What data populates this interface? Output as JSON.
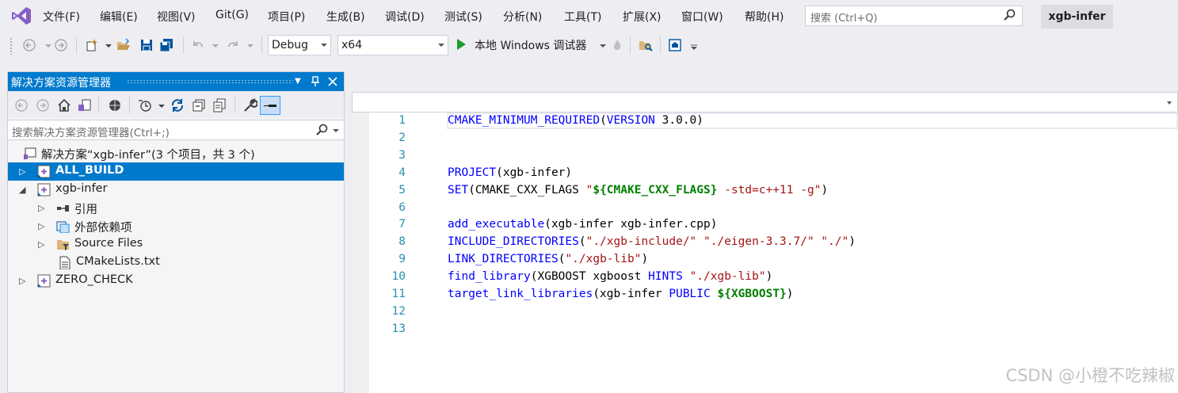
{
  "menu": {
    "logo": "visual-studio-logo",
    "items": [
      "文件(F)",
      "编辑(E)",
      "视图(V)",
      "Git(G)",
      "项目(P)",
      "生成(B)",
      "调试(D)",
      "测试(S)",
      "分析(N)",
      "工具(T)",
      "扩展(X)",
      "窗口(W)",
      "帮助(H)"
    ],
    "search_placeholder": "搜索 (Ctrl+Q)",
    "project_name": "xgb-infer"
  },
  "toolbar": {
    "configuration": "Debug",
    "platform": "x64",
    "run_label": "本地 Windows 调试器"
  },
  "solution_explorer": {
    "title": "解决方案资源管理器",
    "search_placeholder": "搜索解决方案资源管理器(Ctrl+;)",
    "tree": [
      {
        "label": "解决方案“xgb-infer”(3 个项目，共 3 个)",
        "icon": "solution-icon",
        "expander": "",
        "selected": false,
        "bold": false
      },
      {
        "label": "ALL_BUILD",
        "icon": "cmake-project-icon",
        "expander": "▷",
        "selected": true,
        "bold": true
      },
      {
        "label": "xgb-infer",
        "icon": "cmake-project-icon",
        "expander": "◢",
        "selected": false,
        "bold": false
      },
      {
        "label": "引用",
        "icon": "references-icon",
        "expander": "▷",
        "selected": false,
        "bold": false
      },
      {
        "label": "外部依赖项",
        "icon": "external-deps-icon",
        "expander": "▷",
        "selected": false,
        "bold": false
      },
      {
        "label": "Source Files",
        "icon": "filter-folder-icon",
        "expander": "▷",
        "selected": false,
        "bold": false
      },
      {
        "label": "CMakeLists.txt",
        "icon": "text-file-icon",
        "expander": "",
        "selected": false,
        "bold": false
      },
      {
        "label": "ZERO_CHECK",
        "icon": "cmake-project-icon",
        "expander": "▷",
        "selected": false,
        "bold": false
      }
    ]
  },
  "editor": {
    "lines": [
      {
        "n": "1",
        "tokens": [
          {
            "t": "CMAKE_MINIMUM_REQUIRED",
            "c": "kw"
          },
          {
            "t": "(",
            "c": "plain"
          },
          {
            "t": "VERSION",
            "c": "kw"
          },
          {
            "t": " 3.0.0)",
            "c": "plain"
          }
        ]
      },
      {
        "n": "2",
        "tokens": []
      },
      {
        "n": "3",
        "tokens": []
      },
      {
        "n": "4",
        "tokens": [
          {
            "t": "PROJECT",
            "c": "kw"
          },
          {
            "t": "(xgb-infer)",
            "c": "plain"
          }
        ]
      },
      {
        "n": "5",
        "tokens": [
          {
            "t": "SET",
            "c": "kw"
          },
          {
            "t": "(CMAKE_CXX_FLAGS ",
            "c": "plain"
          },
          {
            "t": "\"",
            "c": "str"
          },
          {
            "t": "${CMAKE_CXX_FLAGS}",
            "c": "var"
          },
          {
            "t": " -std=c++11 -g\"",
            "c": "str"
          },
          {
            "t": ")",
            "c": "plain"
          }
        ]
      },
      {
        "n": "6",
        "tokens": []
      },
      {
        "n": "7",
        "tokens": [
          {
            "t": "add_executable",
            "c": "kw"
          },
          {
            "t": "(xgb-infer xgb-infer.cpp)",
            "c": "plain"
          }
        ]
      },
      {
        "n": "8",
        "tokens": [
          {
            "t": "INCLUDE_DIRECTORIES",
            "c": "kw"
          },
          {
            "t": "(",
            "c": "plain"
          },
          {
            "t": "\"./xgb-include/\" \"./eigen-3.3.7/\" \"./\"",
            "c": "str"
          },
          {
            "t": ")",
            "c": "plain"
          }
        ]
      },
      {
        "n": "9",
        "tokens": [
          {
            "t": "LINK_DIRECTORIES",
            "c": "kw"
          },
          {
            "t": "(",
            "c": "plain"
          },
          {
            "t": "\"./xgb-lib\"",
            "c": "str"
          },
          {
            "t": ")",
            "c": "plain"
          }
        ]
      },
      {
        "n": "10",
        "tokens": [
          {
            "t": "find_library",
            "c": "kw"
          },
          {
            "t": "(XGBOOST xgboost ",
            "c": "plain"
          },
          {
            "t": "HINTS",
            "c": "kw"
          },
          {
            "t": " ",
            "c": "plain"
          },
          {
            "t": "\"./xgb-lib\"",
            "c": "str"
          },
          {
            "t": ")",
            "c": "plain"
          }
        ]
      },
      {
        "n": "11",
        "tokens": [
          {
            "t": "target_link_libraries",
            "c": "kw"
          },
          {
            "t": "(xgb-infer ",
            "c": "plain"
          },
          {
            "t": "PUBLIC",
            "c": "kw"
          },
          {
            "t": " ",
            "c": "plain"
          },
          {
            "t": "${XGBOOST}",
            "c": "var"
          },
          {
            "t": ")",
            "c": "plain"
          }
        ]
      },
      {
        "n": "12",
        "tokens": []
      },
      {
        "n": "13",
        "tokens": []
      }
    ]
  },
  "watermark": "CSDN @小橙不吃辣椒",
  "colors": {
    "accent": "#007acc",
    "keyword": "#0000ff",
    "string": "#a31515",
    "variable": "#008000",
    "line_number": "#2b91af"
  }
}
